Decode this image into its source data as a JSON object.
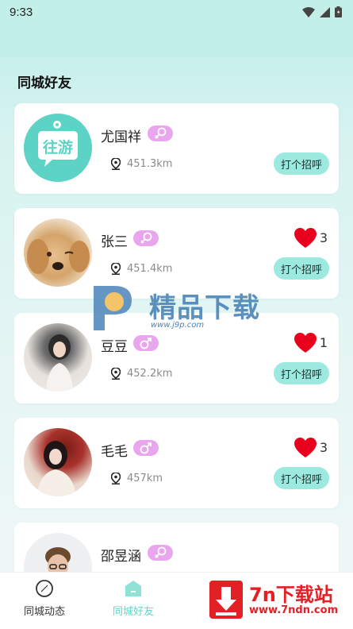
{
  "status_bar": {
    "time": "9:33"
  },
  "section_title": "同城好友",
  "greet_label": "打个招呼",
  "users": [
    {
      "name": "尤国祥",
      "gender": "female",
      "distance": "451.3km",
      "likes": null,
      "avatar": "往游"
    },
    {
      "name": "张三",
      "gender": "female",
      "distance": "451.4km",
      "likes": "3",
      "avatar": "dog"
    },
    {
      "name": "豆豆",
      "gender": "male",
      "distance": "452.2km",
      "likes": "1",
      "avatar": "girl"
    },
    {
      "name": "毛毛",
      "gender": "male",
      "distance": "457km",
      "likes": "3",
      "avatar": "girl2"
    },
    {
      "name": "邵昱涵",
      "gender": "female",
      "distance": "",
      "likes": null,
      "avatar": "man"
    }
  ],
  "bottom_nav": [
    {
      "label": "同城动态",
      "active": false
    },
    {
      "label": "同城好友",
      "active": true
    }
  ],
  "watermarks": {
    "center_text": "精品下载",
    "center_url": "www.j9p.com",
    "corner_title": "7n下载站",
    "corner_url": "www.7ndn.com"
  },
  "colors": {
    "accent": "#9be9df",
    "gender_badge": "#e9a6ef",
    "heart": "#e8001c"
  }
}
